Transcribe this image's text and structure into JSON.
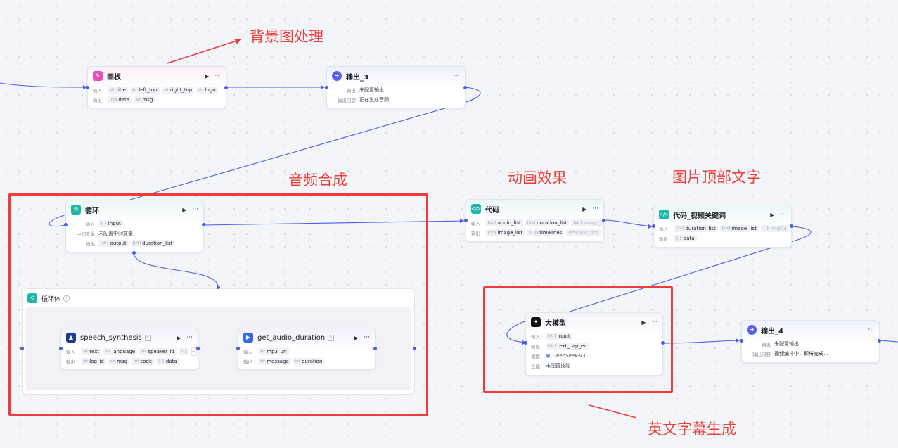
{
  "annotations": {
    "background": "背景图处理",
    "audio": "音频合成",
    "animation": "动画效果",
    "image_top_text": "图片顶部文字",
    "subtitle": "英文字幕生成"
  },
  "labels": {
    "input": "输入",
    "output": "输出",
    "output_content": "输出内容",
    "mid_var": "中间变量",
    "model": "模型",
    "skill": "技能",
    "run": "▶",
    "more": "···",
    "ellipsis": "···"
  },
  "canvas": {
    "title": "画板",
    "inputs": [
      {
        "type": "str",
        "name": "title"
      },
      {
        "type": "str",
        "name": "left_top"
      },
      {
        "type": "str",
        "name": "right_top"
      },
      {
        "type": "str",
        "name": "logo"
      }
    ],
    "outputs": [
      {
        "type": "img",
        "name": "data"
      },
      {
        "type": "str",
        "name": "msg"
      }
    ]
  },
  "output3": {
    "title": "输出_3",
    "output_value": "未配置输出",
    "output_content": "正在生成音频..."
  },
  "loop": {
    "title": "循环",
    "input": {
      "type": "{ }",
      "name": "input"
    },
    "mid_var": "未配置中间变量",
    "outputs": [
      {
        "type": "[str]",
        "name": "output"
      },
      {
        "type": "[int]",
        "name": "duration_list"
      }
    ]
  },
  "loop_body": {
    "title": "循环体"
  },
  "speech": {
    "title": "speech_synthesis",
    "inputs": [
      {
        "type": "str",
        "name": "text"
      },
      {
        "type": "str",
        "name": "language"
      },
      {
        "type": "str",
        "name": "speaker_id"
      },
      {
        "type": "fl",
        "name": "s"
      }
    ],
    "outputs": [
      {
        "type": "str",
        "name": "log_id"
      },
      {
        "type": "str",
        "name": "msg"
      },
      {
        "type": "int",
        "name": "code"
      },
      {
        "type": "{ }",
        "name": "data"
      }
    ]
  },
  "audio_dur": {
    "title": "get_audio_duration",
    "inputs": [
      {
        "type": "str",
        "name": "mp3_url"
      }
    ],
    "outputs": [
      {
        "type": "str",
        "name": "message"
      },
      {
        "type": "int",
        "name": "duration"
      }
    ]
  },
  "code1": {
    "title": "代码",
    "inputs": [
      {
        "type": "[str]",
        "name": "audio_list"
      },
      {
        "type": "[int]",
        "name": "duration_list"
      },
      {
        "type": "[str]",
        "name": "image_"
      }
    ],
    "outputs": [
      {
        "type": "[str]",
        "name": "image_list"
      },
      {
        "type": "[{ }]",
        "name": "timelines"
      },
      {
        "type": "[str]",
        "name": "text_tim"
      }
    ]
  },
  "code2": {
    "title": "代码_视频关键词",
    "inputs": [
      {
        "type": "[int]",
        "name": "duration_list"
      },
      {
        "type": "[str]",
        "name": "image_list"
      },
      {
        "type": "{ }",
        "name": "imgDu"
      }
    ],
    "outputs": [
      {
        "type": "{ }",
        "name": "data"
      }
    ]
  },
  "llm": {
    "title": "大模型",
    "input": {
      "type": "[str]",
      "name": "input"
    },
    "output": {
      "type": "[str]",
      "name": "text_cap_en"
    },
    "model": "DeepSeek-V3",
    "skill": "未配置技能"
  },
  "output4": {
    "title": "输出_4",
    "output_value": "未配置输出",
    "output_content": "视频编排中，即将完成..."
  },
  "colors": {
    "edge": "#4d5cf0",
    "annotation": "#e8403b",
    "canvas_icon": "#e94fb6",
    "output_icon": "#5b5ef0",
    "loop_icon": "#1fb6a8",
    "code_icon": "#1fb6a8",
    "llm_icon": "#111111",
    "plugin_icon": "#3467e8"
  }
}
